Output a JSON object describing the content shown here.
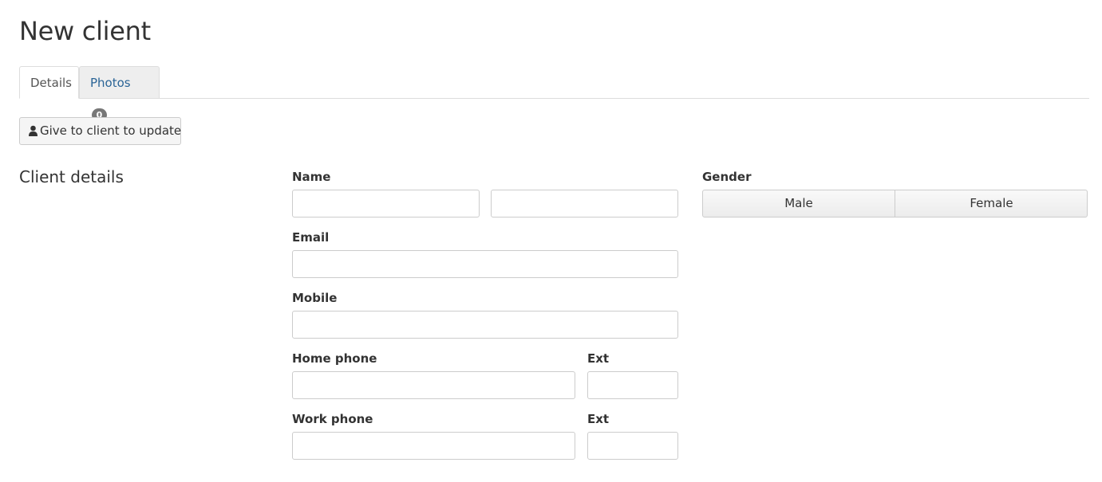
{
  "page": {
    "title": "New client"
  },
  "tabs": [
    {
      "label": "Details"
    },
    {
      "label": "Photos",
      "badge": "0"
    }
  ],
  "actions": {
    "give_to_client_label": "Give to client to update",
    "give_icon": "user-icon"
  },
  "section": {
    "title": "Client details"
  },
  "form": {
    "name_label": "Name",
    "first_name_value": "",
    "last_name_value": "",
    "email_label": "Email",
    "email_value": "",
    "mobile_label": "Mobile",
    "mobile_value": "",
    "home_phone_label": "Home phone",
    "home_phone_value": "",
    "home_ext_label": "Ext",
    "home_ext_value": "",
    "work_phone_label": "Work phone",
    "work_phone_value": "",
    "work_ext_label": "Ext",
    "work_ext_value": "",
    "gender_label": "Gender",
    "gender_options": [
      "Male",
      "Female"
    ]
  },
  "colors": {
    "link": "#2a6496",
    "badge": "#777777",
    "border": "#cccccc"
  }
}
